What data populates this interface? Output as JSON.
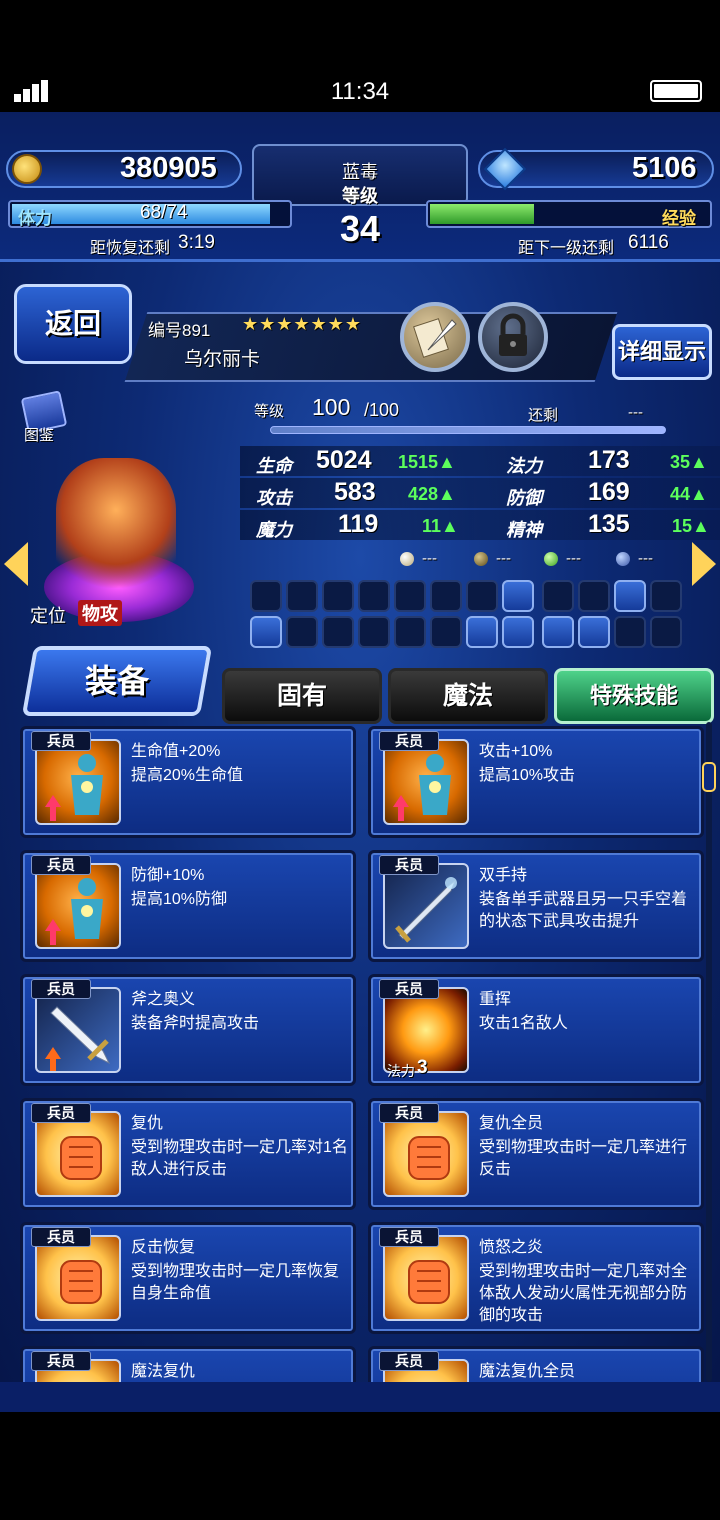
{
  "status": {
    "time": "11:34"
  },
  "hud": {
    "gold": "380905",
    "gems": "5106",
    "player_name": "蓝毒",
    "level_label": "等级",
    "level": "34",
    "stamina_label": "体力",
    "stamina_text": "68/74",
    "stamina_fraction": 0.92,
    "stamina_recover_label": "距恢复还剩",
    "stamina_recover_time": "3:19",
    "exp_label": "经验",
    "exp_fraction": 0.37,
    "exp_next_label": "距下一级还剩",
    "exp_next_value": "6116"
  },
  "unit": {
    "back_label": "返回",
    "number_label": "编号891",
    "stars": "★★★★★★★",
    "name": "乌尔丽卡",
    "detail_label": "详细显示",
    "codex_label": "图鉴",
    "role_label": "定位",
    "role_value": "物攻",
    "level_label": "等级",
    "level_value": "100",
    "level_max": "/100",
    "remaining_label": "还剩",
    "remaining_value": "---"
  },
  "stats": [
    {
      "label": "生命",
      "value": "5024",
      "bonus": "1515"
    },
    {
      "label": "法力",
      "value": "173",
      "bonus": "35"
    },
    {
      "label": "攻击",
      "value": "583",
      "bonus": "428"
    },
    {
      "label": "防御",
      "value": "169",
      "bonus": "44"
    },
    {
      "label": "魔力",
      "value": "119",
      "bonus": "11"
    },
    {
      "label": "精神",
      "value": "135",
      "bonus": "15"
    }
  ],
  "orbs": [
    "---",
    "---",
    "---",
    "---"
  ],
  "tabs": {
    "equip": "装备",
    "innate": "固有",
    "magic": "魔法",
    "special": "特殊技能"
  },
  "abilities": [
    {
      "badge": "兵员",
      "title": "生命值+20%",
      "desc": "提高20%生命值",
      "icon": "body-up-icon"
    },
    {
      "badge": "兵员",
      "title": "攻击+10%",
      "desc": "提高10%攻击",
      "icon": "body-up-icon"
    },
    {
      "badge": "兵员",
      "title": "防御+10%",
      "desc": "提高10%防御",
      "icon": "body-up-icon"
    },
    {
      "badge": "兵员",
      "title": "双手持",
      "desc": "装备单手武器且另一只手空着的状态下武具攻击提升",
      "icon": "sword-icon"
    },
    {
      "badge": "兵员",
      "title": "斧之奥义",
      "desc": "装备斧时提高攻击",
      "icon": "sword-up-icon"
    },
    {
      "badge": "兵员",
      "title": "重挥",
      "desc": "攻击1名敌人",
      "icon": "burst-icon",
      "cost_label": "法力",
      "cost": "3"
    },
    {
      "badge": "兵员",
      "title": "复仇",
      "desc": "受到物理攻击时一定几率对1名敌人进行反击",
      "icon": "fist-icon"
    },
    {
      "badge": "兵员",
      "title": "复仇全员",
      "desc": "受到物理攻击时一定几率进行反击",
      "icon": "fist-icon"
    },
    {
      "badge": "兵员",
      "title": "反击恢复",
      "desc": "受到物理攻击时一定几率恢复自身生命值",
      "icon": "fist-icon"
    },
    {
      "badge": "兵员",
      "title": "愤怒之炎",
      "desc": "受到物理攻击时一定几率对全体敌人发动火属性无视部分防御的攻击",
      "icon": "fist-icon"
    },
    {
      "badge": "兵员",
      "title": "魔法复仇",
      "desc": "",
      "icon": "fist-icon"
    },
    {
      "badge": "兵员",
      "title": "魔法复仇全员",
      "desc": "",
      "icon": "fist-icon"
    }
  ]
}
